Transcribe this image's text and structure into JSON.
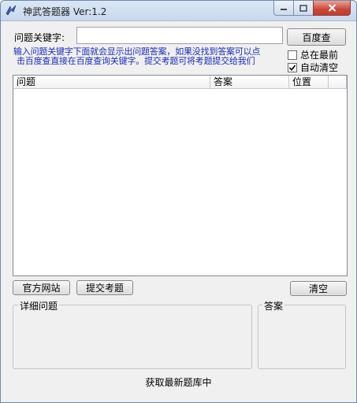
{
  "window": {
    "title": "神武答题器 Ver:1.2",
    "icon": "app-bird-icon",
    "controls": {
      "minimize": "minimize-icon",
      "maximize": "maximize-icon",
      "close": "close-icon"
    }
  },
  "search": {
    "label": "问题关键字:",
    "value": "",
    "button_label": "百度查"
  },
  "hint": {
    "line1": "输入问题关键字下面就会显示出问题答案，如果没找到答案可以点",
    "line2": "击百度查直接在百度查询关键字。提交考题可将考题提交给我们"
  },
  "options": {
    "always_on_top": {
      "label": "总在最前",
      "checked": false
    },
    "auto_clear": {
      "label": "自动清空",
      "checked": true
    }
  },
  "results_table": {
    "columns": [
      "问题",
      "答案",
      "位置"
    ],
    "rows": []
  },
  "actions": {
    "official_site": "官方网站",
    "submit_question": "提交考题",
    "clear": "清空"
  },
  "detail": {
    "question_group": "详细问题",
    "answer_group": "答案",
    "question_text": "",
    "answer_text": ""
  },
  "status": "获取最新题库中"
}
